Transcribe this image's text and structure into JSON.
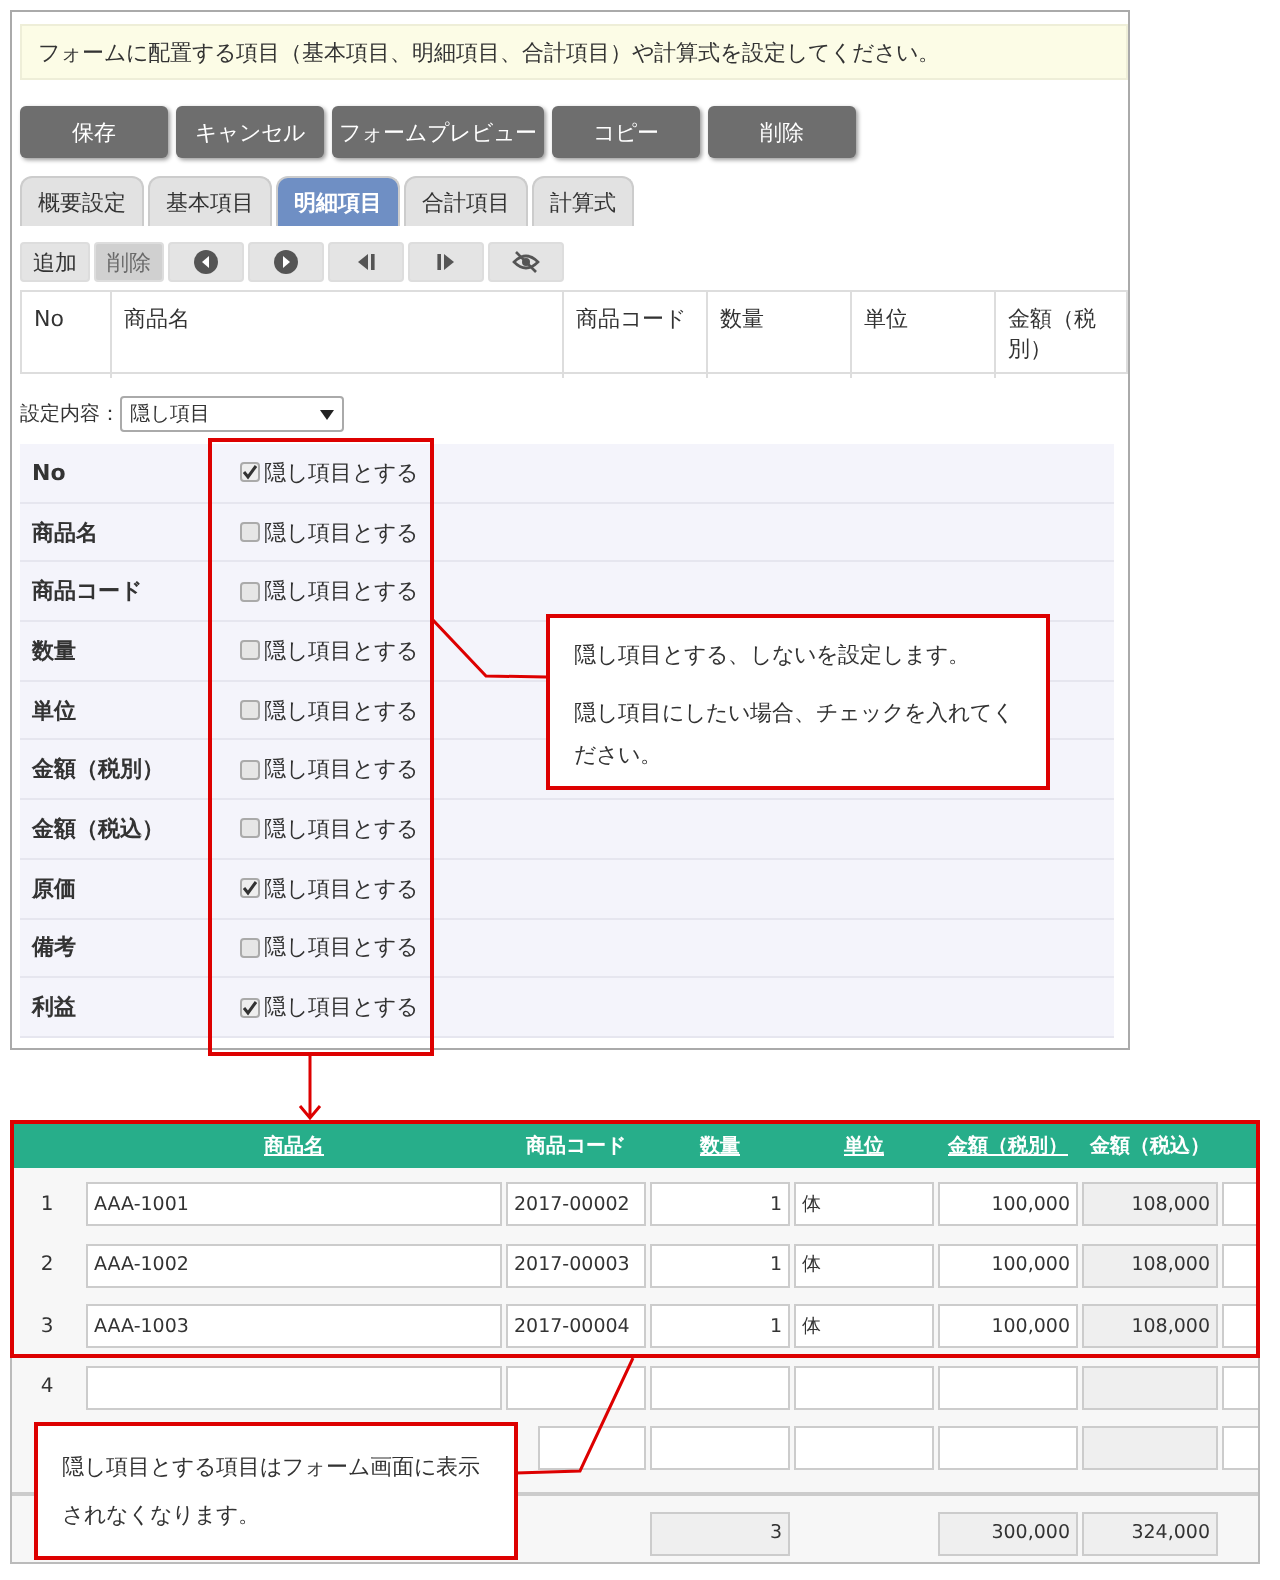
{
  "notice": "フォームに配置する項目（基本項目、明細項目、合計項目）や計算式を設定してください。",
  "buttons": [
    "保存",
    "キャンセル",
    "フォームプレビュー",
    "コピー",
    "削除"
  ],
  "tabs": [
    {
      "label": "概要設定",
      "selected": false
    },
    {
      "label": "基本項目",
      "selected": false
    },
    {
      "label": "明細項目",
      "selected": true
    },
    {
      "label": "合計項目",
      "selected": false
    },
    {
      "label": "計算式",
      "selected": false
    }
  ],
  "toolbar": [
    {
      "label": "追加",
      "disabled": false
    },
    {
      "label": "削除",
      "disabled": true
    }
  ],
  "columns": [
    "No",
    "商品名",
    "商品コード",
    "数量",
    "単位",
    "金額（税別）"
  ],
  "setting": {
    "label": "設定内容：",
    "value": "隠し項目"
  },
  "fields": [
    {
      "name": "No",
      "option": "隠し項目とする",
      "checked": true
    },
    {
      "name": "商品名",
      "option": "隠し項目とする",
      "checked": false
    },
    {
      "name": "商品コード",
      "option": "隠し項目とする",
      "checked": false
    },
    {
      "name": "数量",
      "option": "隠し項目とする",
      "checked": false
    },
    {
      "name": "単位",
      "option": "隠し項目とする",
      "checked": false
    },
    {
      "name": "金額（税別）",
      "option": "隠し項目とする",
      "checked": false
    },
    {
      "name": "金額（税込）",
      "option": "隠し項目とする",
      "checked": false
    },
    {
      "name": "原価",
      "option": "隠し項目とする",
      "checked": true
    },
    {
      "name": "備考",
      "option": "隠し項目とする",
      "checked": false
    },
    {
      "name": "利益",
      "option": "隠し項目とする",
      "checked": true
    }
  ],
  "callout_top": [
    "隠し項目とする、しないを設定します。",
    "隠し項目にしたい場合、チェックを入れてください。"
  ],
  "form": {
    "columns": [
      {
        "label": "商品名",
        "link": true
      },
      {
        "label": "商品コード",
        "link": false
      },
      {
        "label": "数量",
        "link": true
      },
      {
        "label": "単位",
        "link": true
      },
      {
        "label": "金額（税別）",
        "link": true
      },
      {
        "label": "金額（税込）",
        "link": false
      }
    ],
    "rows": [
      {
        "no": "1",
        "name": "AAA-1001",
        "code": "2017-00002",
        "qty": "1",
        "unit": "体",
        "amount_ex": "100,000",
        "amount_in": "108,000"
      },
      {
        "no": "2",
        "name": "AAA-1002",
        "code": "2017-00003",
        "qty": "1",
        "unit": "体",
        "amount_ex": "100,000",
        "amount_in": "108,000"
      },
      {
        "no": "3",
        "name": "AAA-1003",
        "code": "2017-00004",
        "qty": "1",
        "unit": "体",
        "amount_ex": "100,000",
        "amount_in": "108,000"
      },
      {
        "no": "4"
      },
      {}
    ],
    "totals": {
      "qty": "3",
      "amount_ex": "300,000",
      "amount_in": "324,000"
    }
  },
  "callout_bottom": [
    "隠し項目とする項目はフォーム画面に表示",
    "されなくなります。"
  ]
}
